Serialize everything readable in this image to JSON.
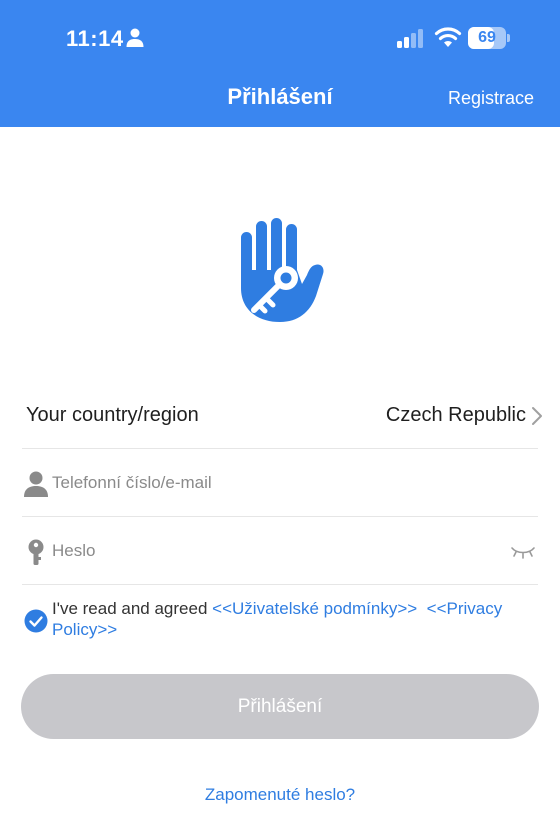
{
  "status_bar": {
    "time": "11:14",
    "battery_percent": 69,
    "battery_label": "69"
  },
  "header": {
    "title": "Přihlášení",
    "register_label": "Registrace",
    "background_color": "#3a86f0"
  },
  "logo": {
    "icon": "hand-key-icon",
    "color": "#2f7de1"
  },
  "country": {
    "label": "Your country/region",
    "value": "Czech Republic"
  },
  "phone_field": {
    "placeholder": "Telefonní číslo/e-mail",
    "value": ""
  },
  "password_field": {
    "placeholder": "Heslo",
    "value": ""
  },
  "agreement": {
    "checked": true,
    "text": "I've read and agreed",
    "terms_link": "<<Uživatelské podmínky>>",
    "privacy_link": "<<Privacy Policy>>"
  },
  "login_button": {
    "label": "Přihlášení",
    "enabled": false
  },
  "forgot_link": "Zapomenuté heslo?"
}
